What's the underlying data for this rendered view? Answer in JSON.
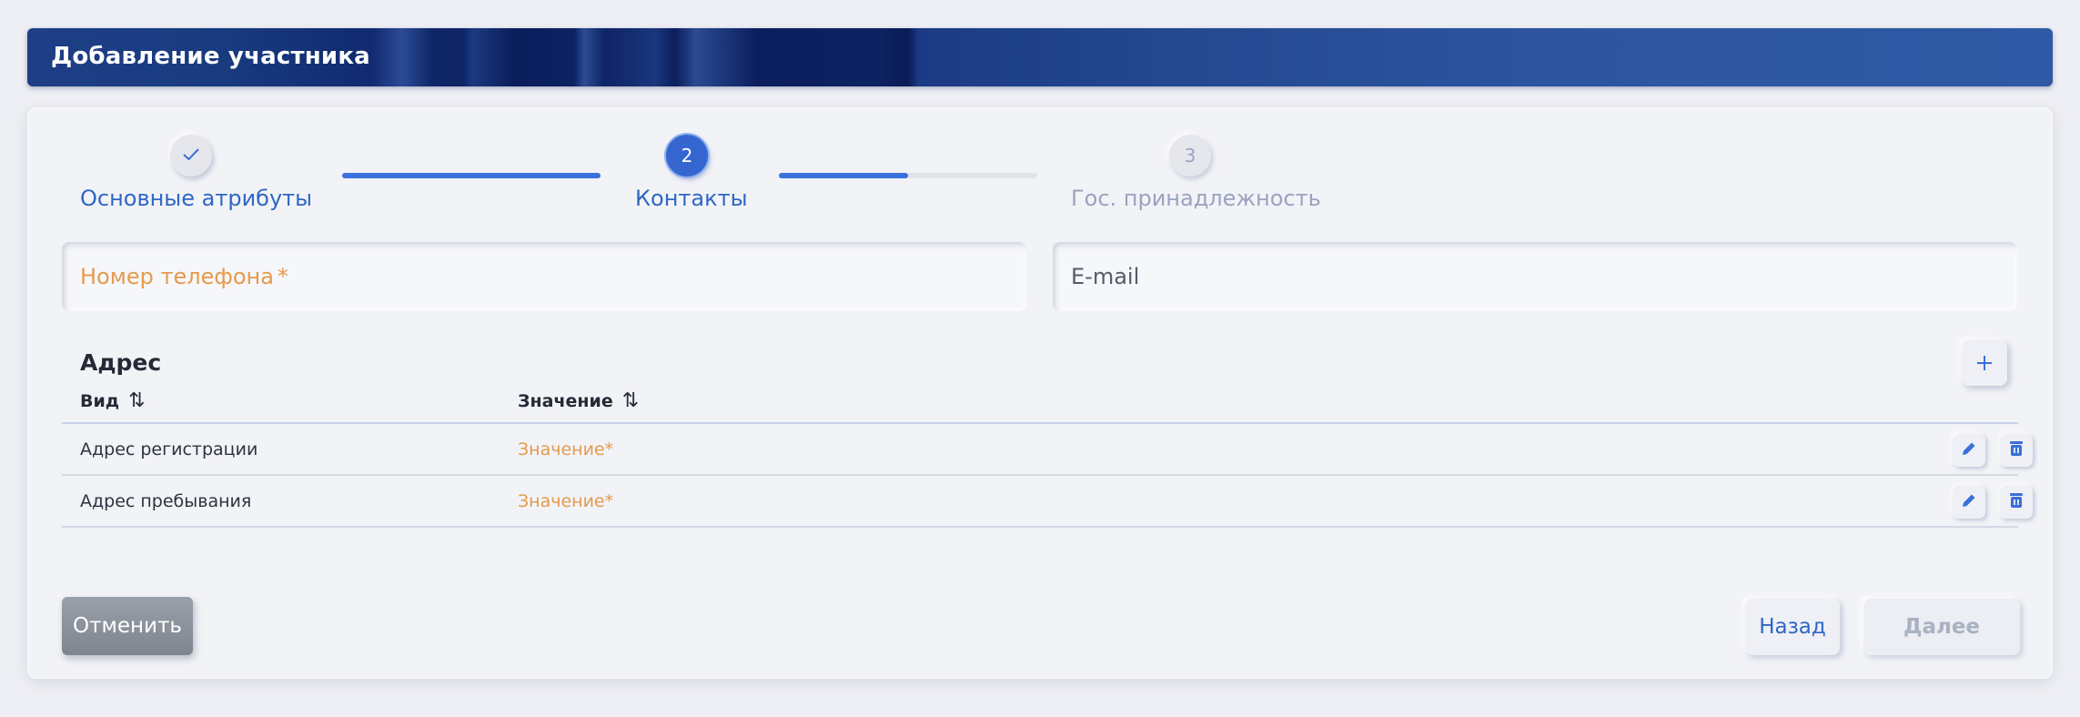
{
  "header": {
    "title": "Добавление участника"
  },
  "stepper": {
    "steps": [
      {
        "number": "",
        "label": "Основные атрибуты",
        "state": "completed",
        "icon": "check-icon"
      },
      {
        "number": "2",
        "label": "Контакты",
        "state": "active"
      },
      {
        "number": "3",
        "label": "Гос. принадлежность",
        "state": "pending"
      }
    ],
    "connector_progress": [
      1.0,
      0.5
    ]
  },
  "form": {
    "phone": {
      "label": "Номер телефона",
      "required_mark": "*"
    },
    "email": {
      "label": "E-mail"
    }
  },
  "address": {
    "title": "Адрес",
    "add_icon": "plus-icon",
    "columns": [
      {
        "label": "Вид",
        "sort_icon": "sort-icon"
      },
      {
        "label": "Значение",
        "sort_icon": "sort-icon"
      }
    ],
    "rows": [
      {
        "kind": "Адрес регистрации",
        "value": "Значение*"
      },
      {
        "kind": "Адрес пребывания",
        "value": "Значение*"
      }
    ],
    "row_actions": [
      "edit-icon",
      "trash-icon"
    ]
  },
  "footer": {
    "cancel_label": "Отменить",
    "back_label": "Назад",
    "next_label": "Далее"
  },
  "colors": {
    "accent": "#3566d0",
    "required": "#e59a4c",
    "header_dark": "#0d2262",
    "header_light": "#2f59a4"
  }
}
